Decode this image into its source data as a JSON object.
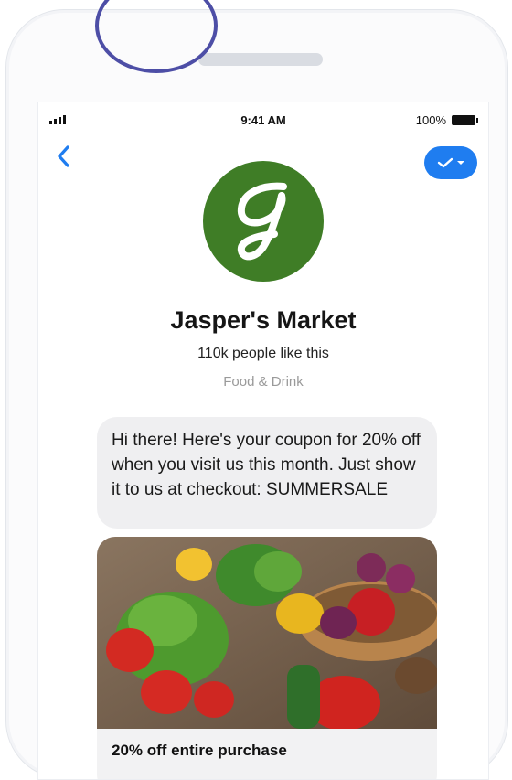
{
  "status_bar": {
    "time": "9:41 AM",
    "battery": "100%"
  },
  "page": {
    "name": "Jasper's Market",
    "likes": "110k people like this",
    "category": "Food & Drink"
  },
  "message": {
    "text": "Hi there! Here's your coupon for 20% off when you visit us this month. Just show it to us at checkout: SUMMERSALE"
  },
  "card": {
    "caption": "20% off entire purchase"
  },
  "icons": {
    "back": "chevron-left-icon",
    "menu": "check-dropdown-icon",
    "logo": "jasper-market-logo"
  },
  "colors": {
    "accent": "#1f7df0",
    "logo_green": "#3f7d26",
    "ring": "#4d4ea6"
  }
}
